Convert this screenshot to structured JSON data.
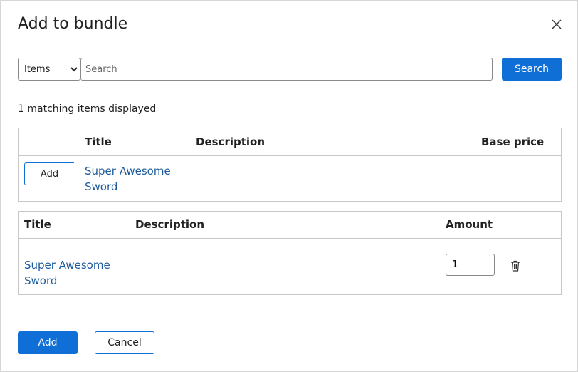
{
  "dialog": {
    "title": "Add to bundle",
    "close_icon": "close-icon"
  },
  "search": {
    "type_selected": "Items",
    "type_options": [
      "Items"
    ],
    "placeholder": "Search",
    "value": "",
    "button_label": "Search"
  },
  "results": {
    "count_text": "1 matching items displayed",
    "columns": [
      "Title",
      "Description",
      "Base price"
    ],
    "rows": [
      {
        "add_label": "Add",
        "title": "Super Awesome Sword",
        "description": "",
        "base_price": ""
      }
    ]
  },
  "bundle": {
    "columns": [
      "Title",
      "Description",
      "Amount"
    ],
    "rows": [
      {
        "title": "Super Awesome Sword",
        "description": "",
        "amount": "1",
        "remove_icon": "trash-icon"
      }
    ]
  },
  "footer": {
    "add_label": "Add",
    "cancel_label": "Cancel"
  },
  "colors": {
    "primary": "#0f6fd6",
    "link": "#1b5a9b",
    "border": "#c8c8c8"
  }
}
